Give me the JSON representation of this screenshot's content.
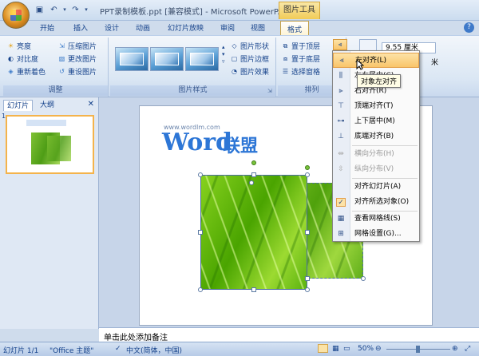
{
  "window": {
    "title": "PPT录制模板.ppt [兼容模式] - Microsoft PowerP...",
    "context_tab_group": "图片工具"
  },
  "qat": [
    "save-icon",
    "undo-icon",
    "redo-icon"
  ],
  "ribbon_tabs": [
    "开始",
    "插入",
    "设计",
    "动画",
    "幻灯片放映",
    "审阅",
    "视图",
    "格式"
  ],
  "active_tab": "格式",
  "ribbon": {
    "adjust": {
      "label": "调整",
      "items": [
        "亮度",
        "对比度",
        "重新着色",
        "压缩图片",
        "更改图片",
        "重设图片"
      ]
    },
    "picture_styles": {
      "label": "图片样式",
      "items": [
        "图片形状",
        "图片边框",
        "图片效果"
      ]
    },
    "arrange": {
      "label": "排列",
      "items": [
        "置于顶层",
        "置于底层",
        "选择窗格"
      ]
    },
    "size": {
      "width_value": "9.55 厘米",
      "height_unit": "米"
    }
  },
  "left_pane": {
    "tabs": [
      "幻灯片",
      "大纲"
    ],
    "slide_number": "1"
  },
  "slide": {
    "watermark_url": "www.wordlm.com",
    "watermark_word": "Word",
    "watermark_cn": "联盟",
    "faint_text": "左对"
  },
  "notes_placeholder": "单击此处添加备注",
  "status": {
    "slide_info": "幻灯片 1/1",
    "theme": "\"Office 主题\"",
    "language": "中文(简体，中国)",
    "zoom": "50%"
  },
  "align_menu": {
    "items": [
      {
        "label": "左对齐(L)",
        "icon": "align-left-icon",
        "state": "hover"
      },
      {
        "label": "左右居中(C)",
        "icon": "align-center-icon",
        "state": "normal"
      },
      {
        "label": "右对齐(R)",
        "icon": "align-right-icon",
        "state": "normal"
      },
      {
        "label": "顶端对齐(T)",
        "icon": "align-top-icon",
        "state": "normal"
      },
      {
        "label": "上下居中(M)",
        "icon": "align-middle-icon",
        "state": "normal"
      },
      {
        "label": "底端对齐(B)",
        "icon": "align-bottom-icon",
        "state": "normal"
      },
      {
        "label": "横向分布(H)",
        "icon": "distribute-horizontal-icon",
        "state": "disabled"
      },
      {
        "label": "纵向分布(V)",
        "icon": "distribute-vertical-icon",
        "state": "disabled"
      },
      {
        "label": "对齐幻灯片(A)",
        "icon": "",
        "state": "normal"
      },
      {
        "label": "对齐所选对象(O)",
        "icon": "check-icon",
        "state": "checked"
      },
      {
        "label": "查看网格线(S)",
        "icon": "gridlines-icon",
        "state": "normal"
      },
      {
        "label": "网格设置(G)...",
        "icon": "grid-settings-icon",
        "state": "normal"
      }
    ],
    "tooltip": "对象左对齐"
  },
  "colors": {
    "ribbon_text": "#15428b",
    "hover_orange": "#f9c56a",
    "leaf_green": "#4fa10c"
  }
}
